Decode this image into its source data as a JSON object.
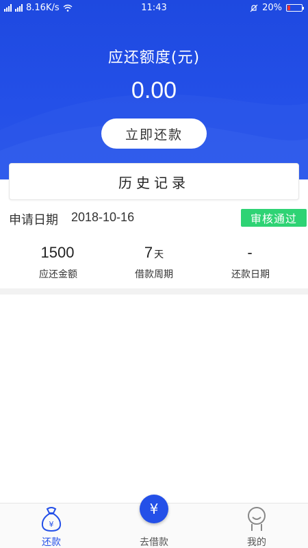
{
  "status_bar": {
    "network_speed": "8.16K/s",
    "time": "11:43",
    "battery": "20%",
    "battery_level": 0.2
  },
  "header": {
    "amount_title": "应还额度(元)",
    "amount_value": "0.00",
    "repay_button": "立即还款"
  },
  "history": {
    "title": "历史记录"
  },
  "record": {
    "date_label": "申请日期",
    "date_value": "2018-10-16",
    "status": "审核通过",
    "stats": [
      {
        "value": "1500",
        "unit": "",
        "caption": "应还金额"
      },
      {
        "value": "7",
        "unit": "天",
        "caption": "借款周期"
      },
      {
        "value": "-",
        "unit": "",
        "caption": "还款日期"
      }
    ]
  },
  "nav": {
    "items": [
      {
        "label": "还款",
        "icon": "money-bag-icon"
      },
      {
        "label": "去借款",
        "icon": "yen-icon"
      },
      {
        "label": "我的",
        "icon": "user-icon"
      }
    ],
    "fab_symbol": "¥"
  },
  "colors": {
    "primary": "#2450e8",
    "status_green": "#2ed374",
    "battery_low": "#ee3333"
  }
}
